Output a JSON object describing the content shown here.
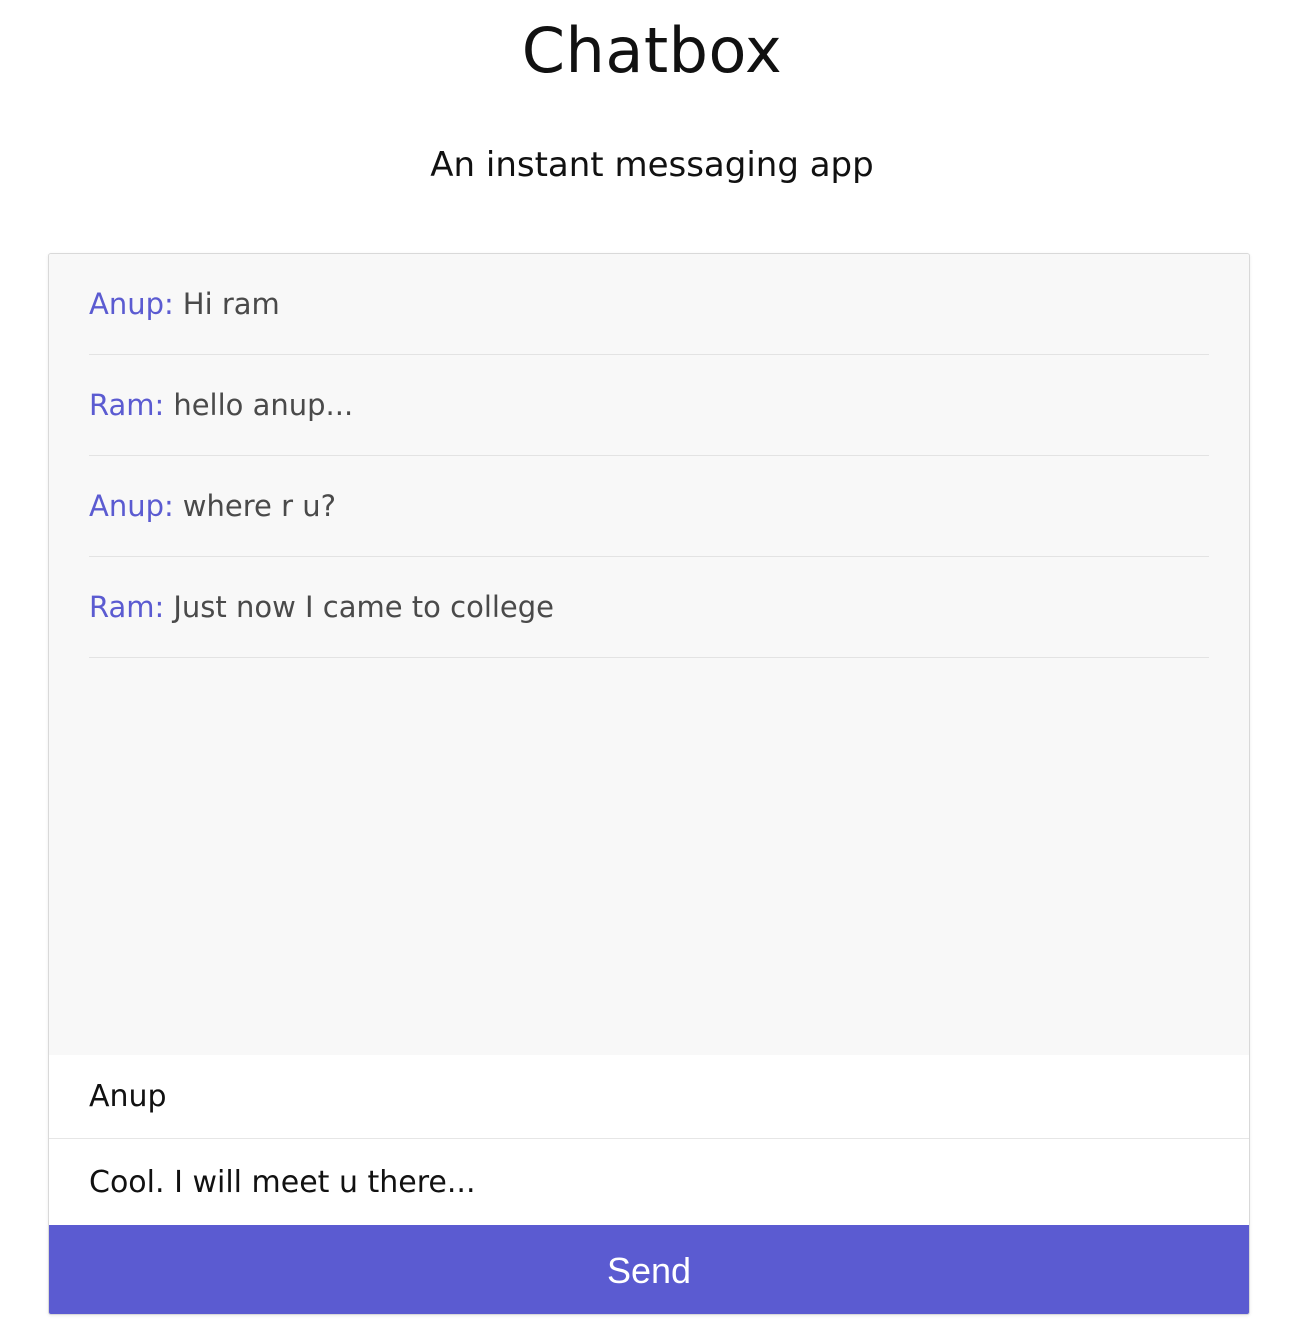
{
  "header": {
    "title": "Chatbox",
    "subtitle": "An instant messaging app"
  },
  "messages": [
    {
      "sender": "Anup:",
      "text": "Hi ram"
    },
    {
      "sender": "Ram:",
      "text": "hello anup..."
    },
    {
      "sender": "Anup:",
      "text": "where r u?"
    },
    {
      "sender": "Ram:",
      "text": "Just now I came to college"
    }
  ],
  "composer": {
    "name_value": "Anup",
    "message_value": "Cool. I will meet u there...",
    "send_label": "Send"
  },
  "colors": {
    "accent": "#5b5bd1",
    "message_area_bg": "#f8f8f8"
  }
}
